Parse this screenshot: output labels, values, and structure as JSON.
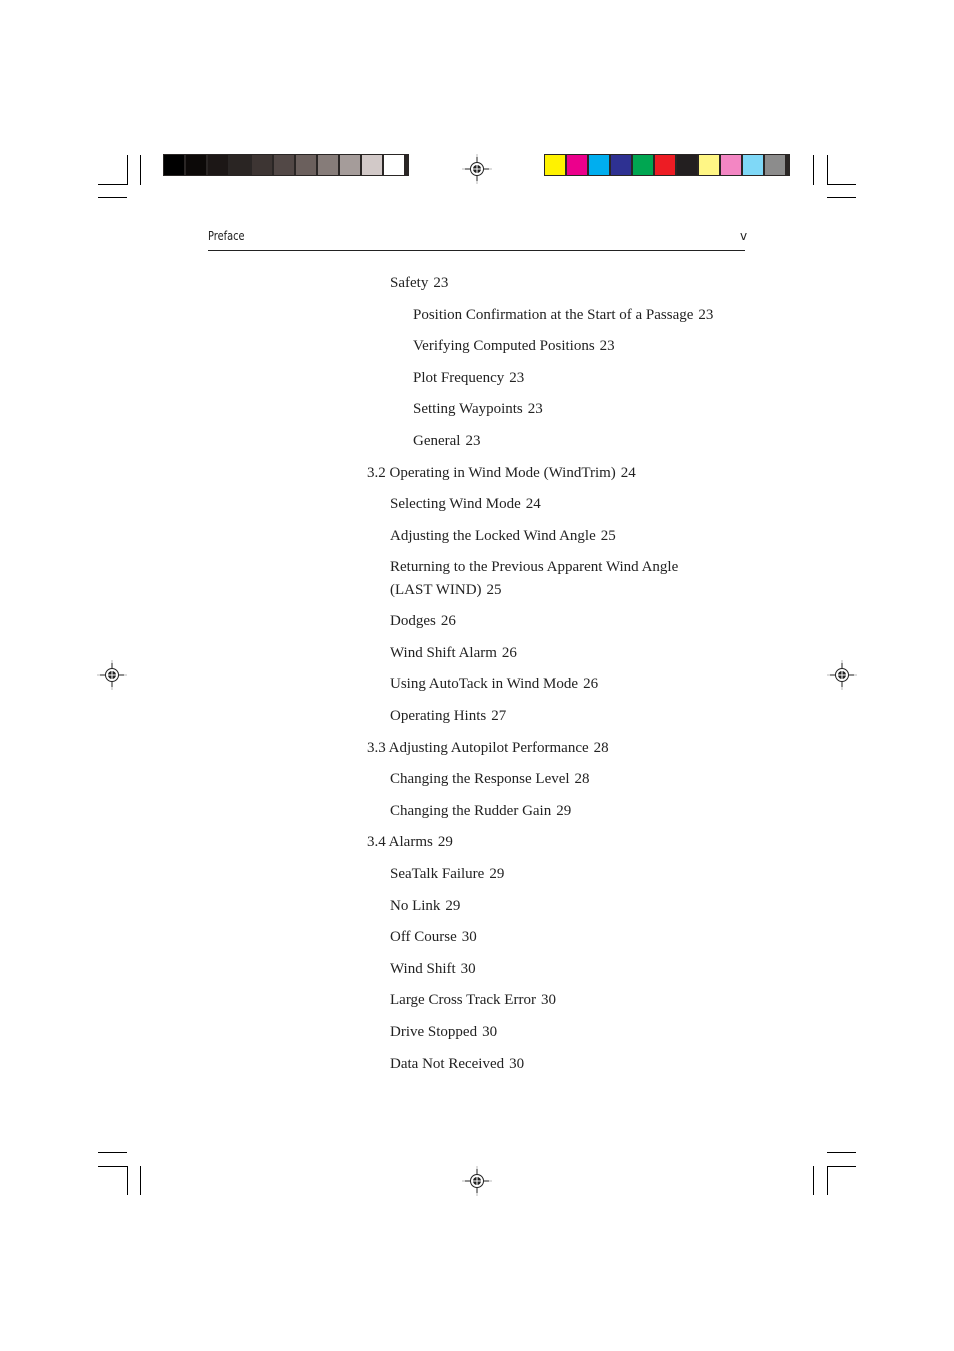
{
  "header": {
    "section": "Preface",
    "page_number": "v"
  },
  "print_marks": {
    "grayscale_swatches": [
      "#000000",
      "#0c0908",
      "#1c1716",
      "#2a2523",
      "#3d3533",
      "#524846",
      "#6b605d",
      "#867c79",
      "#a59c9a",
      "#d2c9c8",
      "#ffffff"
    ],
    "color_swatches": [
      "#fff200",
      "#ec008c",
      "#00aeef",
      "#2e3192",
      "#00a651",
      "#ed1c24",
      "#231f20",
      "#fff685",
      "#f386c3",
      "#7fd8f7",
      "#8c8c8c"
    ],
    "registration_icon": "crosshair-registration-mark"
  },
  "toc": {
    "entries": [
      {
        "level": 2,
        "title": "Safety",
        "page": "23"
      },
      {
        "level": 3,
        "title": "Position Confirmation at the Start of a Passage",
        "page": "23",
        "leader": ".."
      },
      {
        "level": 3,
        "title": "Verifying Computed Positions",
        "page": "23"
      },
      {
        "level": 3,
        "title": "Plot Frequency",
        "page": "23"
      },
      {
        "level": 3,
        "title": "Setting Waypoints",
        "page": "23"
      },
      {
        "level": 3,
        "title": "General",
        "page": "23"
      },
      {
        "level": 1,
        "title": "3.2 Operating in Wind Mode (WindTrim)",
        "page": "24"
      },
      {
        "level": 2,
        "title": "Selecting Wind Mode",
        "page": "24"
      },
      {
        "level": 2,
        "title": "Adjusting the Locked Wind Angle",
        "page": "25"
      },
      {
        "level": 2,
        "title_line1": "Returning to the Previous Apparent Wind Angle",
        "title": "(LAST WIND)",
        "page": "25"
      },
      {
        "level": 2,
        "title": "Dodges",
        "page": "26"
      },
      {
        "level": 2,
        "title": "Wind Shift Alarm",
        "page": "26"
      },
      {
        "level": 2,
        "title": "Using AutoTack in Wind Mode",
        "page": "26"
      },
      {
        "level": 2,
        "title": "Operating Hints",
        "page": "27"
      },
      {
        "level": 1,
        "title": "3.3 Adjusting Autopilot Performance",
        "page": "28"
      },
      {
        "level": 2,
        "title": "Changing the Response Level",
        "page": "28"
      },
      {
        "level": 2,
        "title": "Changing the Rudder Gain",
        "page": "29"
      },
      {
        "level": 1,
        "title": "3.4 Alarms",
        "page": "29"
      },
      {
        "level": 2,
        "title": "SeaTalk Failure",
        "page": "29"
      },
      {
        "level": 2,
        "title": "No Link",
        "page": "29"
      },
      {
        "level": 2,
        "title": "Off Course",
        "page": "30"
      },
      {
        "level": 2,
        "title": "Wind Shift",
        "page": "30"
      },
      {
        "level": 2,
        "title": "Large Cross Track Error",
        "page": "30"
      },
      {
        "level": 2,
        "title": "Drive Stopped",
        "page": "30"
      },
      {
        "level": 2,
        "title": "Data Not Received",
        "page": "30"
      }
    ]
  }
}
